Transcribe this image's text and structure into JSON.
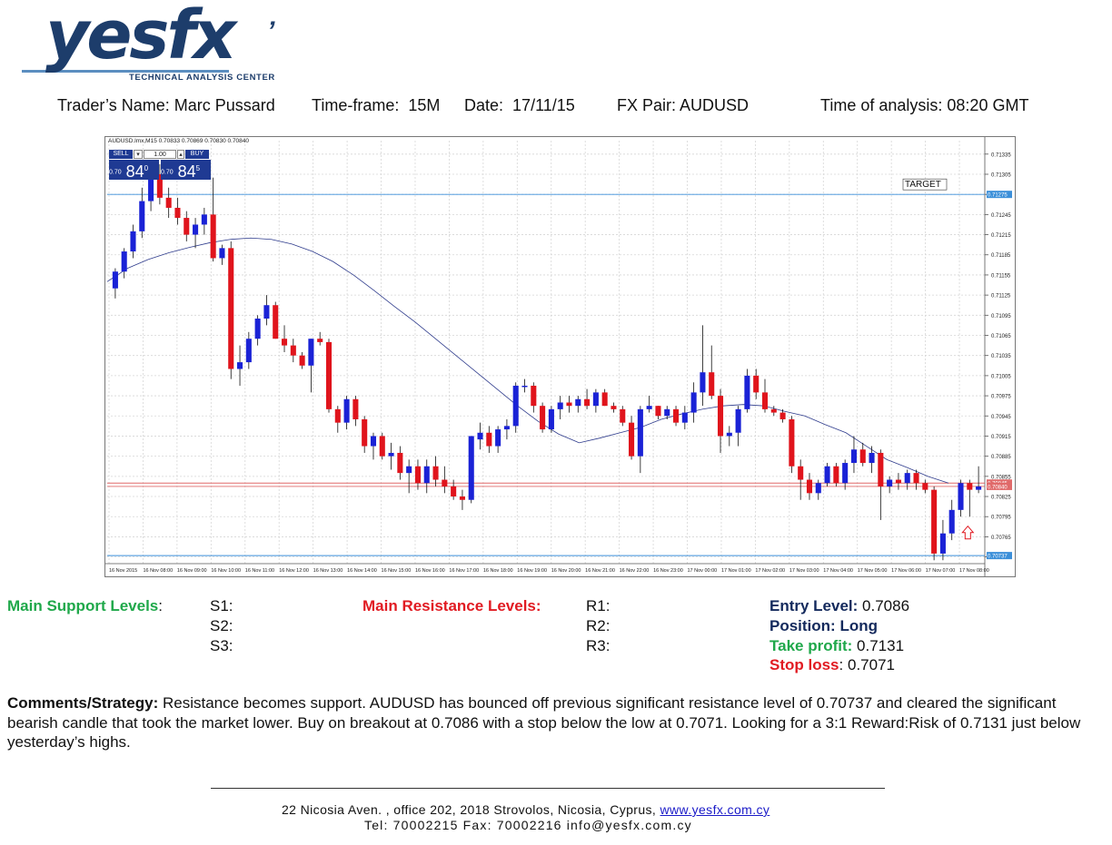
{
  "logo": {
    "name": "yesfx",
    "tagline": "TECHNICAL ANALYSIS CENTER",
    "color": "#1d3d6b"
  },
  "header": {
    "trader_label": "Trader’s Name:",
    "trader": "Marc Pussard",
    "timeframe_label": "Time-frame:",
    "timeframe": "15M",
    "date_label": "Date:",
    "date": "17/11/15",
    "pair_label": "FX Pair:",
    "pair": "AUDUSD",
    "time_label": "Time of analysis:",
    "time": "08:20 GMT"
  },
  "trade_panel": {
    "symbol_line": "AUDUSD.lmx,M15  0.70833 0.70869 0.70830 0.70840",
    "sell_label": "SELL",
    "buy_label": "BUY",
    "lot": "1.00",
    "sell_prefix": "0.70",
    "sell_big": "84",
    "sell_sup": "0",
    "buy_prefix": "0.70",
    "buy_big": "84",
    "buy_sup": "5"
  },
  "chart_data": {
    "type": "candlestick",
    "target_label": "TARGET",
    "ylim": [
      0.70725,
      0.71355
    ],
    "yticks": [
      0.71335,
      0.71305,
      0.71275,
      0.71245,
      0.71215,
      0.71185,
      0.71155,
      0.71125,
      0.71095,
      0.71065,
      0.71035,
      0.71005,
      0.70975,
      0.70945,
      0.70915,
      0.70885,
      0.70855,
      0.70825,
      0.70795,
      0.70765,
      0.70735
    ],
    "hlines": [
      {
        "value": 0.71275,
        "color": "#3b8fd9",
        "label": "0.71275"
      },
      {
        "value": 0.70845,
        "color": "#e06a6a",
        "label": "0.70845"
      },
      {
        "value": 0.7084,
        "color": "#e06a6a",
        "label": "0.70840"
      },
      {
        "value": 0.70737,
        "color": "#3b8fd9",
        "label": "0.70737"
      }
    ],
    "xticks": [
      "16 Nov 2015",
      "16 Nov 08:00",
      "16 Nov 09:00",
      "16 Nov 10:00",
      "16 Nov 11:00",
      "16 Nov 12:00",
      "16 Nov 13:00",
      "16 Nov 14:00",
      "16 Nov 15:00",
      "16 Nov 16:00",
      "16 Nov 17:00",
      "16 Nov 18:00",
      "16 Nov 19:00",
      "16 Nov 20:00",
      "16 Nov 21:00",
      "16 Nov 22:00",
      "16 Nov 23:00",
      "17 Nov 00:00",
      "17 Nov 01:00",
      "17 Nov 02:00",
      "17 Nov 03:00",
      "17 Nov 04:00",
      "17 Nov 05:00",
      "17 Nov 06:00",
      "17 Nov 07:00",
      "17 Nov 08:00"
    ],
    "candles": [
      [
        0.71135,
        0.71165,
        0.7112,
        0.7116
      ],
      [
        0.7116,
        0.71195,
        0.7115,
        0.7119
      ],
      [
        0.7119,
        0.7123,
        0.7118,
        0.7122
      ],
      [
        0.7122,
        0.71285,
        0.7121,
        0.71265
      ],
      [
        0.71265,
        0.7132,
        0.7125,
        0.71305
      ],
      [
        0.71305,
        0.7132,
        0.7126,
        0.7127
      ],
      [
        0.7127,
        0.71285,
        0.7124,
        0.71255
      ],
      [
        0.71255,
        0.7127,
        0.7123,
        0.7124
      ],
      [
        0.7124,
        0.7125,
        0.71205,
        0.71215
      ],
      [
        0.71215,
        0.7124,
        0.71195,
        0.7123
      ],
      [
        0.7123,
        0.71255,
        0.71215,
        0.71245
      ],
      [
        0.71245,
        0.713,
        0.71175,
        0.7118
      ],
      [
        0.7118,
        0.712,
        0.7117,
        0.71195
      ],
      [
        0.71195,
        0.71205,
        0.71,
        0.71015
      ],
      [
        0.71015,
        0.7105,
        0.7099,
        0.71025
      ],
      [
        0.71025,
        0.7107,
        0.71015,
        0.7106
      ],
      [
        0.7106,
        0.71095,
        0.7105,
        0.7109
      ],
      [
        0.7109,
        0.71125,
        0.7108,
        0.7111
      ],
      [
        0.7111,
        0.71115,
        0.7106,
        0.7106
      ],
      [
        0.7106,
        0.7108,
        0.7104,
        0.7105
      ],
      [
        0.7105,
        0.7106,
        0.71025,
        0.71035
      ],
      [
        0.71035,
        0.7104,
        0.71015,
        0.7102
      ],
      [
        0.7102,
        0.7106,
        0.7098,
        0.7106
      ],
      [
        0.7106,
        0.7107,
        0.7105,
        0.71055
      ],
      [
        0.71055,
        0.7106,
        0.7095,
        0.70955
      ],
      [
        0.70955,
        0.7096,
        0.7092,
        0.70935
      ],
      [
        0.70935,
        0.70975,
        0.70925,
        0.7097
      ],
      [
        0.7097,
        0.70975,
        0.7093,
        0.7094
      ],
      [
        0.7094,
        0.70945,
        0.7089,
        0.709
      ],
      [
        0.709,
        0.7092,
        0.7088,
        0.70915
      ],
      [
        0.70915,
        0.7092,
        0.7088,
        0.70885
      ],
      [
        0.70885,
        0.70905,
        0.70865,
        0.7089
      ],
      [
        0.7089,
        0.709,
        0.7085,
        0.7086
      ],
      [
        0.7086,
        0.7088,
        0.7083,
        0.7087
      ],
      [
        0.7087,
        0.7088,
        0.70835,
        0.70845
      ],
      [
        0.70845,
        0.7088,
        0.7083,
        0.7087
      ],
      [
        0.7087,
        0.70885,
        0.7084,
        0.7085
      ],
      [
        0.7085,
        0.7087,
        0.7083,
        0.7084
      ],
      [
        0.7084,
        0.7085,
        0.7082,
        0.70825
      ],
      [
        0.70825,
        0.70835,
        0.70805,
        0.7082
      ],
      [
        0.7082,
        0.7087,
        0.70815,
        0.70915
      ],
      [
        0.7091,
        0.70935,
        0.70895,
        0.7092
      ],
      [
        0.7092,
        0.7093,
        0.7089,
        0.709
      ],
      [
        0.709,
        0.7093,
        0.7089,
        0.70925
      ],
      [
        0.70925,
        0.7094,
        0.7091,
        0.7093
      ],
      [
        0.7093,
        0.70995,
        0.7092,
        0.7099
      ],
      [
        0.7099,
        0.71,
        0.7098,
        0.7099
      ],
      [
        0.7099,
        0.70995,
        0.7095,
        0.7096
      ],
      [
        0.7096,
        0.70965,
        0.7092,
        0.70925
      ],
      [
        0.70925,
        0.7096,
        0.7092,
        0.70955
      ],
      [
        0.70955,
        0.70975,
        0.7094,
        0.70965
      ],
      [
        0.70965,
        0.70975,
        0.7095,
        0.7096
      ],
      [
        0.7096,
        0.70975,
        0.7095,
        0.7097
      ],
      [
        0.7097,
        0.70985,
        0.70955,
        0.7096
      ],
      [
        0.7096,
        0.70985,
        0.7095,
        0.7098
      ],
      [
        0.7098,
        0.70985,
        0.7096,
        0.7096
      ],
      [
        0.7096,
        0.70965,
        0.7095,
        0.70955
      ],
      [
        0.70955,
        0.7096,
        0.7093,
        0.70935
      ],
      [
        0.70935,
        0.70945,
        0.7088,
        0.70885
      ],
      [
        0.70885,
        0.7096,
        0.7086,
        0.70955
      ],
      [
        0.70955,
        0.70975,
        0.7095,
        0.7096
      ],
      [
        0.7096,
        0.7096,
        0.7094,
        0.70945
      ],
      [
        0.70945,
        0.7096,
        0.7094,
        0.70955
      ],
      [
        0.70955,
        0.7096,
        0.7093,
        0.70935
      ],
      [
        0.70935,
        0.7096,
        0.70925,
        0.7095
      ],
      [
        0.7095,
        0.70995,
        0.70935,
        0.7098
      ],
      [
        0.7098,
        0.7108,
        0.7096,
        0.7101
      ],
      [
        0.7101,
        0.7105,
        0.7097,
        0.70975
      ],
      [
        0.70975,
        0.70985,
        0.7089,
        0.70915
      ],
      [
        0.70915,
        0.7093,
        0.709,
        0.7092
      ],
      [
        0.7092,
        0.7096,
        0.709,
        0.70955
      ],
      [
        0.70955,
        0.71015,
        0.7095,
        0.71005
      ],
      [
        0.71005,
        0.71015,
        0.7097,
        0.7098
      ],
      [
        0.7098,
        0.71,
        0.7095,
        0.70955
      ],
      [
        0.70955,
        0.7096,
        0.70945,
        0.7095
      ],
      [
        0.7095,
        0.70955,
        0.70935,
        0.7094
      ],
      [
        0.7094,
        0.70945,
        0.7086,
        0.7087
      ],
      [
        0.7087,
        0.7088,
        0.7082,
        0.7085
      ],
      [
        0.7085,
        0.7086,
        0.7082,
        0.7083
      ],
      [
        0.7083,
        0.7085,
        0.7082,
        0.70845
      ],
      [
        0.70845,
        0.70875,
        0.7084,
        0.7087
      ],
      [
        0.7087,
        0.70875,
        0.7084,
        0.70845
      ],
      [
        0.70845,
        0.7088,
        0.70835,
        0.70875
      ],
      [
        0.70875,
        0.70915,
        0.7086,
        0.70895
      ],
      [
        0.70895,
        0.70905,
        0.7087,
        0.70875
      ],
      [
        0.70875,
        0.709,
        0.7086,
        0.7089
      ],
      [
        0.7089,
        0.70895,
        0.7079,
        0.7084
      ],
      [
        0.7084,
        0.70855,
        0.7083,
        0.7085
      ],
      [
        0.7085,
        0.7086,
        0.70835,
        0.70845
      ],
      [
        0.70845,
        0.70865,
        0.70835,
        0.7086
      ],
      [
        0.7086,
        0.70865,
        0.70835,
        0.70845
      ],
      [
        0.70845,
        0.7085,
        0.7083,
        0.70835
      ],
      [
        0.70835,
        0.7084,
        0.7073,
        0.7074
      ],
      [
        0.7074,
        0.7079,
        0.7073,
        0.7077
      ],
      [
        0.7077,
        0.7082,
        0.7076,
        0.70805
      ],
      [
        0.70805,
        0.7085,
        0.70795,
        0.70845
      ],
      [
        0.70845,
        0.7085,
        0.70795,
        0.70835
      ],
      [
        0.70835,
        0.7087,
        0.7083,
        0.7084
      ]
    ],
    "ma": [
      0.71145,
      0.71165,
      0.71178,
      0.71188,
      0.71196,
      0.71203,
      0.71208,
      0.7121,
      0.71208,
      0.71201,
      0.7119,
      0.71175,
      0.71155,
      0.71132,
      0.71108,
      0.71085,
      0.7106,
      0.71035,
      0.7101,
      0.70985,
      0.7096,
      0.70937,
      0.70918,
      0.70905,
      0.70912,
      0.7092,
      0.70928,
      0.7094,
      0.70948,
      0.70955,
      0.7096,
      0.70962,
      0.7096,
      0.70952,
      0.70945,
      0.70932,
      0.7092,
      0.709,
      0.7088,
      0.70868,
      0.70855,
      0.70845
    ]
  },
  "levels": {
    "support_label": "Main Support Levels",
    "support_colon": ":",
    "s1": "S1:",
    "s2": "S2:",
    "s3": "S3:",
    "resistance_label": "Main Resistance Levels:",
    "r1": "R1:",
    "r2": "R2:",
    "r3": "R3:",
    "entry_label": "Entry Level:",
    "entry": "0.7086",
    "position_label": "Position:",
    "position": "Long",
    "tp_label": "Take profit:",
    "tp": "0.7131",
    "sl_label": "Stop loss",
    "sl_colon": ":",
    "sl": "0.7071"
  },
  "comments": {
    "label": "Comments/Strategy:",
    "text": "Resistance becomes support. AUDUSD has bounced off previous significant resistance level of 0.70737 and cleared the significant bearish candle that took the market lower. Buy on breakout at 0.7086 with a stop below the low at 0.7071. Looking for a 3:1 Reward:Risk of 0.7131 just below yesterday’s highs."
  },
  "footer": {
    "address": "22 Nicosia Aven. , office 202, 2018 Strovolos, Nicosia, Cyprus,",
    "website": "www.yesfx.com.cy",
    "contact": "Tel:  70002215  Fax:  70002216  info@yesfx.com.cy"
  }
}
